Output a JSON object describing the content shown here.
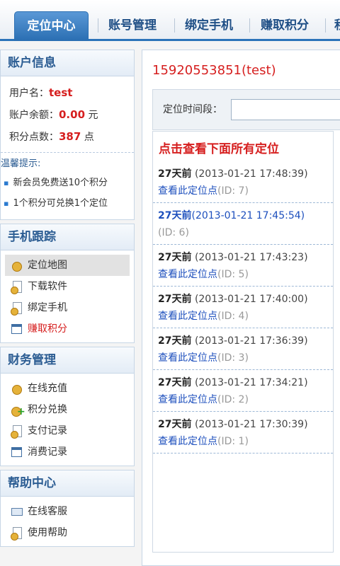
{
  "tabs": [
    {
      "label": "定位中心",
      "active": true
    },
    {
      "label": "账号管理"
    },
    {
      "label": "绑定手机"
    },
    {
      "label": "赚取积分"
    },
    {
      "label": "积"
    }
  ],
  "account": {
    "title": "账户信息",
    "username_label": "用户名：",
    "username": "test",
    "balance_label": "账户余额：",
    "balance": "0.00",
    "balance_unit": "元",
    "points_label": "积分点数：",
    "points": "387",
    "points_unit": "点",
    "tips_title": "温馨提示:",
    "tips": [
      "新会员免费送10个积分",
      "1个积分可兑换1个定位"
    ]
  },
  "tracking": {
    "title": "手机跟踪",
    "items": [
      {
        "label": "定位地图",
        "icon": "coins-icon"
      },
      {
        "label": "下载软件",
        "icon": "document-icon"
      },
      {
        "label": "绑定手机",
        "icon": "document-icon"
      },
      {
        "label": "赚取积分",
        "icon": "calendar-icon"
      }
    ]
  },
  "finance": {
    "title": "财务管理",
    "items": [
      {
        "label": "在线充值",
        "icon": "coins-icon"
      },
      {
        "label": "积分兑换",
        "icon": "add-coins-icon"
      },
      {
        "label": "支付记录",
        "icon": "document-icon"
      },
      {
        "label": "消费记录",
        "icon": "calendar-icon"
      }
    ]
  },
  "help": {
    "title": "帮助中心",
    "items": [
      {
        "label": "在线客服",
        "icon": "mail-icon"
      },
      {
        "label": "使用帮助",
        "icon": "document-icon"
      }
    ]
  },
  "main": {
    "phone_title": "15920553851(test)",
    "filter_label": "定位时间段：",
    "filter_value": "",
    "view_all": "点击查看下面所有定位",
    "records": [
      {
        "ago": "27天前",
        "time": "(2013-01-21 17:48:39)",
        "view": "查看此定位点",
        "id": "(ID: 7)"
      },
      {
        "ago": "27天前",
        "time": "(2013-01-21 17:45:54)",
        "view": "",
        "id": "(ID: 6)"
      },
      {
        "ago": "27天前",
        "time": "(2013-01-21 17:43:23)",
        "view": "查看此定位点",
        "id": "(ID: 5)"
      },
      {
        "ago": "27天前",
        "time": "(2013-01-21 17:40:00)",
        "view": "查看此定位点",
        "id": "(ID: 4)"
      },
      {
        "ago": "27天前",
        "time": "(2013-01-21 17:36:39)",
        "view": "查看此定位点",
        "id": "(ID: 3)"
      },
      {
        "ago": "27天前",
        "time": "(2013-01-21 17:34:21)",
        "view": "查看此定位点",
        "id": "(ID: 2)"
      },
      {
        "ago": "27天前",
        "time": "(2013-01-21 17:30:39)",
        "view": "查看此定位点",
        "id": "(ID: 1)"
      }
    ]
  },
  "colors": {
    "accent": "#2b73b9",
    "highlight_red": "#d61f1f",
    "link_blue": "#1d4fbd"
  }
}
